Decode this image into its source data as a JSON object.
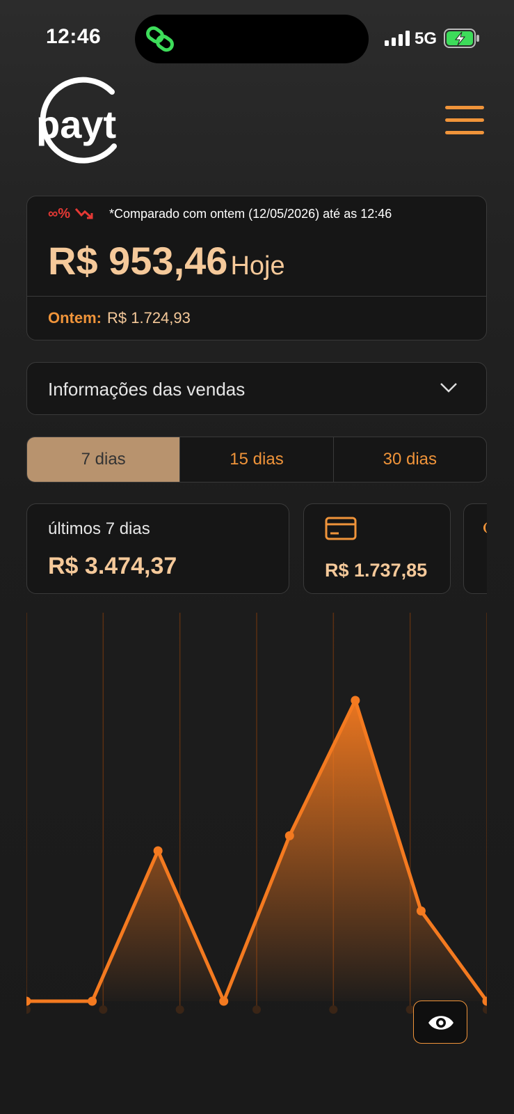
{
  "status_bar": {
    "time": "12:46",
    "network": "5G",
    "icons": [
      "link-icon",
      "signal-icon",
      "battery-charging-icon"
    ]
  },
  "header": {
    "logo_text": "payt",
    "menu_icon": "hamburger-icon"
  },
  "today_card": {
    "comparison_symbol": "∞%",
    "comparison_icon": "trend-down-icon",
    "comparison_text": "*Comparado com ontem (12/05/2026) até as 12:46",
    "amount": "R$ 953,46",
    "amount_suffix": "Hoje",
    "yesterday_label": "Ontem:",
    "yesterday_value": "R$ 1.724,93"
  },
  "info_dropdown": {
    "label": "Informações das vendas",
    "icon": "chevron-down-icon"
  },
  "period_tabs": [
    {
      "label": "7 dias",
      "active": true
    },
    {
      "label": "15 dias",
      "active": false
    },
    {
      "label": "30 dias",
      "active": false
    }
  ],
  "stats": {
    "total_label": "últimos 7 dias",
    "total_value": "R$ 3.474,37",
    "card_icon": "credit-card-icon",
    "card_value": "R$ 1.737,85"
  },
  "colors": {
    "accent": "#f0943a",
    "line": "#f47a20",
    "highlight": "#f5c99a",
    "negative": "#e53935",
    "active_tab": "#b8936e"
  },
  "chart_data": {
    "type": "area",
    "points": 8,
    "values": [
      0,
      0,
      0.4,
      0,
      0.44,
      0.8,
      0.24,
      0
    ]
  },
  "toggle_button": {
    "icon": "eye-icon"
  }
}
